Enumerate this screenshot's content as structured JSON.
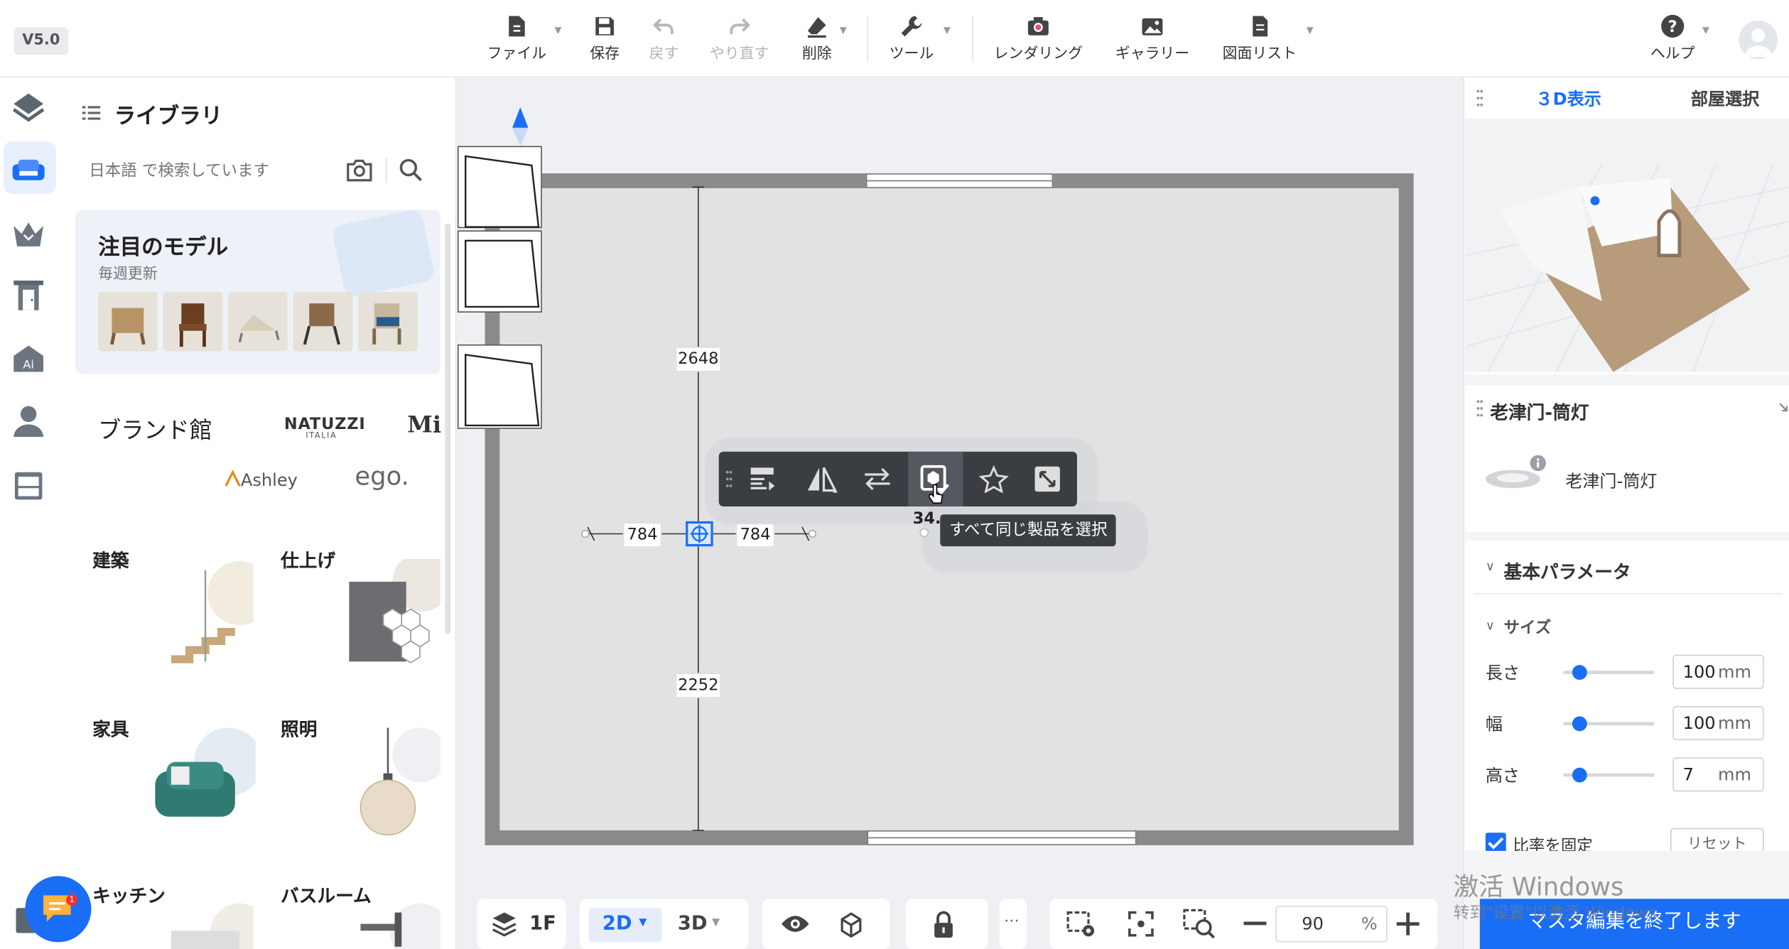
{
  "version": "V5.0",
  "toolbar": {
    "file": "ファイル",
    "save": "保存",
    "undo": "戻す",
    "redo": "やり直す",
    "delete": "削除",
    "tools": "ツール",
    "rendering": "レンダリング",
    "gallery": "ギャラリー",
    "drawing_list": "図面リスト",
    "help": "ヘルプ"
  },
  "library": {
    "title": "ライブラリ",
    "search_placeholder": "日本語 で検索しています",
    "featured_title": "注目のモデル",
    "featured_subtitle": "毎週更新",
    "brand_title": "ブランド館",
    "brands": [
      "NATUZZI",
      "ITALIA",
      "Mi",
      "Ashley",
      "ego."
    ],
    "categories": [
      {
        "label": "建築"
      },
      {
        "label": "仕上げ"
      },
      {
        "label": "家具"
      },
      {
        "label": "照明"
      },
      {
        "label": "キッチン"
      },
      {
        "label": "バスルーム"
      }
    ]
  },
  "canvas": {
    "dim_top": "2648",
    "dim_bottom": "2252",
    "dim_left": "784",
    "dim_right": "784",
    "angle_label": "34.",
    "tooltip": "すべて同じ製品を選択"
  },
  "right_panel": {
    "tab_3d": "３D表示",
    "tab_room": "部屋選択",
    "product_title": "老津门-筒灯",
    "product_name": "老津门-筒灯",
    "section_basic": "基本パラメータ",
    "section_size": "サイズ",
    "params": [
      {
        "label": "長さ",
        "value": "100",
        "unit": "mm"
      },
      {
        "label": "幅",
        "value": "100",
        "unit": "mm"
      },
      {
        "label": "高さ",
        "value": "7",
        "unit": "mm"
      }
    ],
    "lock_ratio": "比率を固定",
    "reset": "リセット",
    "finish_button": "マスタ編集を終了します",
    "watermark_line1": "激活 Windows",
    "watermark_line2": "转到\"设置\"以激活 Windows。"
  },
  "bottombar": {
    "floor": "1F",
    "mode_2d": "2D",
    "mode_3d": "3D",
    "more": "···",
    "zoom": "90",
    "zoom_unit": "%"
  },
  "colors": {
    "accent": "#1a6ef5",
    "wall": "#8a8a8a",
    "floor": "#e2e2e2",
    "dark_toolbar": "#3a3d42"
  }
}
